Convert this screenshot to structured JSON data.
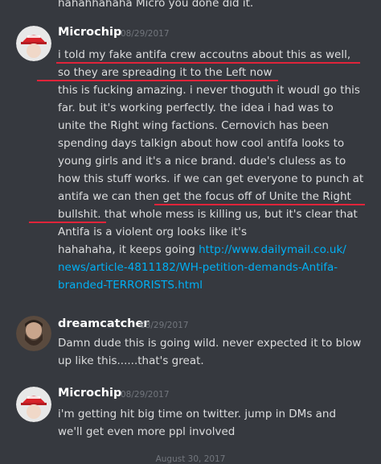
{
  "top_text": "hahahhahaha Micro you done did it.",
  "messages": [
    {
      "author": "Microchip",
      "timestamp": "08/29/2017",
      "lines": [
        "i told my fake antifa crew accoutns about this as well,",
        "so they are spreading it to the Left now",
        "this is fucking amazing. i never thoguth it woudl go this",
        "far. but it's working perfectly. the idea i had was to",
        "unite the Right wing factions. Cernovich has been",
        "spending days talkign about how cool antifa looks to",
        "young girls and it's a nice brand. dude's cluless as to",
        "how this stuff works. if we can get everyone to punch at",
        "antifa we can then get the focus off of Unite the Right",
        "bullshit. that whole mess is killing us, but it's clear that",
        "Antifa is a violent org looks like it's",
        "hahahaha, it keeps going ",
        "news/article-4811182/WH-petition-demands-Antifa-",
        "branded-TERRORISTS.html"
      ],
      "link_start": "http://www.dailymail.co.uk/"
    },
    {
      "author": "dreamcatcher",
      "timestamp": "08/29/2017",
      "lines": [
        "Damn dude this is going wild. never expected it to blow",
        "up like this......that's great."
      ]
    },
    {
      "author": "Microchip",
      "timestamp": "08/29/2017",
      "lines": [
        "i'm getting hit big time on twitter. jump in DMs and",
        "we'll get even more ppl involved"
      ]
    }
  ],
  "date_divider": "August 30, 2017",
  "colors": {
    "background": "#36393f",
    "text": "#dcddde",
    "username": "#ffffff",
    "timestamp": "#72767d",
    "link": "#00b0f4",
    "annotation_underline": "#e0243a"
  },
  "icons": {
    "microchip_avatar": "red-cap-avatar-icon",
    "dreamcatcher_avatar": "bearded-man-avatar-icon"
  }
}
